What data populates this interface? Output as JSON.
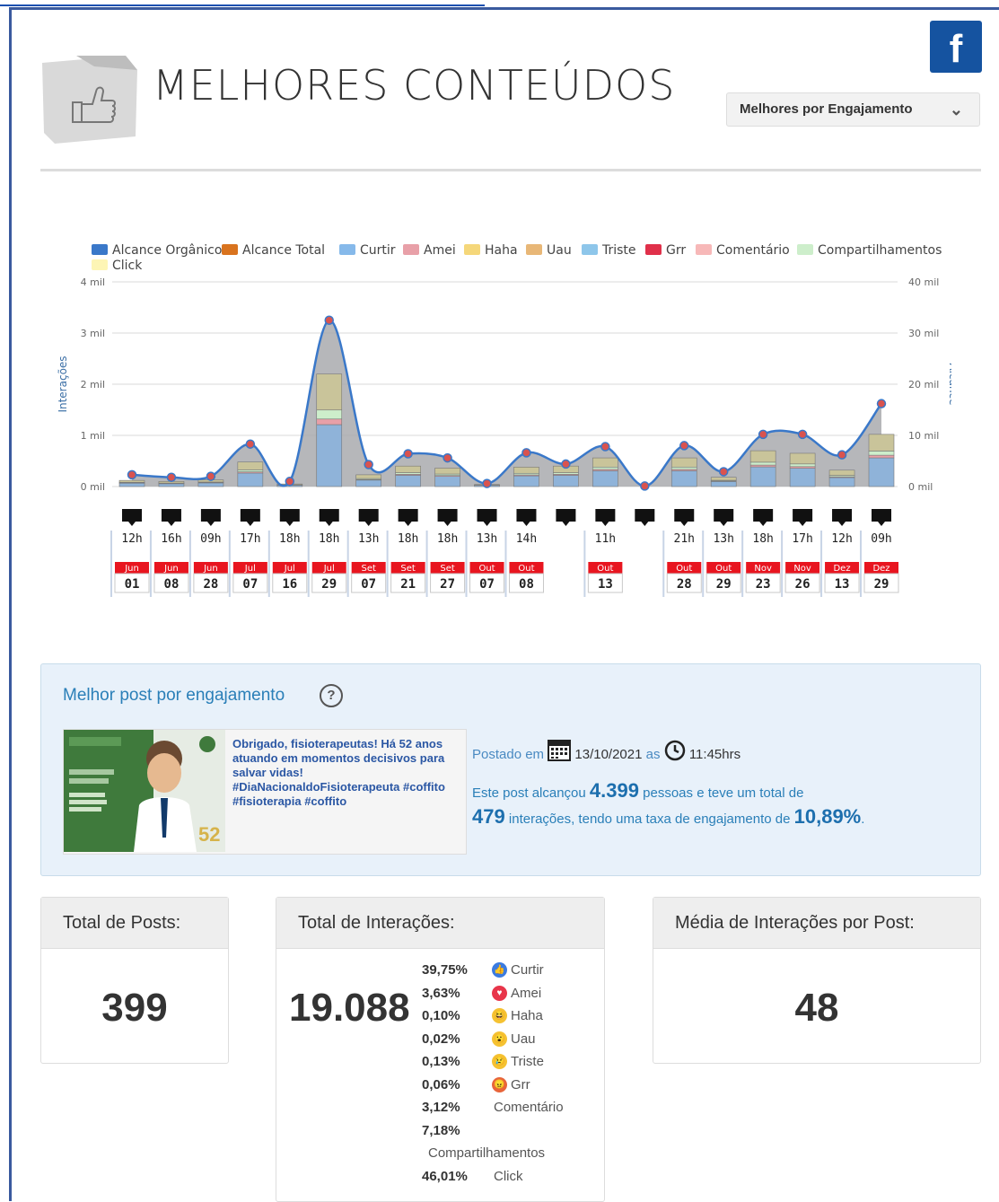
{
  "header": {
    "title": "MELHORES CONTEÚDOS",
    "facebook_letter": "f",
    "sort_select": {
      "value": "Melhores por Engajamento"
    }
  },
  "chart_data": {
    "type": "line",
    "legend": [
      "Alcance Orgânico",
      "Alcance Total",
      "Curtir",
      "Amei",
      "Haha",
      "Uau",
      "Triste",
      "Grr",
      "Comentário",
      "Compartilhamentos",
      "Click"
    ],
    "legend_colors": [
      "#3a78c9",
      "#d9731e",
      "#86b9ea",
      "#e8a0a8",
      "#f5d77a",
      "#e8b777",
      "#8ec6ea",
      "#e0304a",
      "#f7b8b8",
      "#cdeecb",
      "#fdf5b5"
    ],
    "y_left_label": "Interações",
    "y_right_label": "Alcance",
    "y_left_ticks": [
      "4 mil",
      "3 mil",
      "2 mil",
      "1 mil",
      "0 mil"
    ],
    "y_right_ticks": [
      "40 mil",
      "30 mil",
      "20 mil",
      "10 mil",
      "0 mil"
    ],
    "ylim_left": [
      0,
      4000
    ],
    "ylim_right": [
      0,
      40000
    ],
    "interactions_line": [
      230,
      180,
      200,
      830,
      100,
      3250,
      430,
      640,
      560,
      60,
      660,
      440,
      780,
      10,
      800,
      290,
      1020,
      1020,
      620,
      1620
    ],
    "stack_height": [
      120,
      100,
      130,
      480,
      50,
      2200,
      230,
      400,
      360,
      40,
      380,
      400,
      560,
      0,
      560,
      180,
      700,
      650,
      320,
      1020
    ],
    "posts": [
      {
        "hour": "12h",
        "month": "Jun",
        "day": "01"
      },
      {
        "hour": "16h",
        "month": "Jun",
        "day": "08"
      },
      {
        "hour": "09h",
        "month": "Jun",
        "day": "28"
      },
      {
        "hour": "17h",
        "month": "Jul",
        "day": "07"
      },
      {
        "hour": "18h",
        "month": "Jul",
        "day": "16"
      },
      {
        "hour": "18h",
        "month": "Jul",
        "day": "29"
      },
      {
        "hour": "13h",
        "month": "Set",
        "day": "07"
      },
      {
        "hour": "18h",
        "month": "Set",
        "day": "21"
      },
      {
        "hour": "18h",
        "month": "Set",
        "day": "27"
      },
      {
        "hour": "13h",
        "month": "Out",
        "day": "07"
      },
      {
        "hour": "14h",
        "month": "Out",
        "day": "08"
      },
      {
        "hour": "",
        "month": "",
        "day": ""
      },
      {
        "hour": "11h",
        "month": "Out",
        "day": "13"
      },
      {
        "hour": "",
        "month": "",
        "day": ""
      },
      {
        "hour": "21h",
        "month": "Out",
        "day": "28"
      },
      {
        "hour": "13h",
        "month": "Out",
        "day": "29"
      },
      {
        "hour": "18h",
        "month": "Nov",
        "day": "23"
      },
      {
        "hour": "17h",
        "month": "Nov",
        "day": "26"
      },
      {
        "hour": "12h",
        "month": "Dez",
        "day": "13"
      },
      {
        "hour": "09h",
        "month": "Dez",
        "day": "29"
      }
    ]
  },
  "best_post": {
    "title": "Melhor post por engajamento",
    "help_icon": "?",
    "post_text": "Obrigado, fisioterapeutas! Há 52 anos atuando em momentos decisivos para salvar vidas! #DiaNacionaldoFisioterapeuta #coffito #fisioterapia #coffito",
    "posted_prefix": "Postado em",
    "date": "13/10/2021",
    "at": "as",
    "time": "11:45hrs",
    "reach_prefix": "Este post alcançou",
    "reach": "4.399",
    "reach_suffix": "pessoas e teve um total de",
    "interactions": "479",
    "interactions_suffix": "interações, tendo uma taxa de engajamento de",
    "engagement_rate": "10,89%",
    "period": "."
  },
  "stats": {
    "total_posts_label": "Total de Posts:",
    "total_posts": "399",
    "total_interactions_label": "Total de Interações:",
    "total_interactions": "19.088",
    "average_label": "Média de Interações por Post:",
    "average": "48",
    "breakdown": [
      {
        "pct": "39,75%",
        "label": "Curtir",
        "icon": "like-icon",
        "color": "#3b7be0"
      },
      {
        "pct": "3,63%",
        "label": "Amei",
        "icon": "love-icon",
        "color": "#e8354a"
      },
      {
        "pct": "0,10%",
        "label": "Haha",
        "icon": "haha-icon",
        "color": "#f5c232"
      },
      {
        "pct": "0,02%",
        "label": "Uau",
        "icon": "wow-icon",
        "color": "#f5c232"
      },
      {
        "pct": "0,13%",
        "label": "Triste",
        "icon": "sad-icon",
        "color": "#f5c232"
      },
      {
        "pct": "0,06%",
        "label": "Grr",
        "icon": "angry-icon",
        "color": "#e8653a"
      },
      {
        "pct": "3,12%",
        "label": "Comentário",
        "icon": "",
        "color": ""
      },
      {
        "pct": "7,18%",
        "label": "",
        "icon": "",
        "color": ""
      },
      {
        "pct": "",
        "label": "Compartilhamentos",
        "icon": "",
        "color": ""
      },
      {
        "pct": "46,01%",
        "label": "Click",
        "icon": "",
        "color": ""
      }
    ]
  }
}
